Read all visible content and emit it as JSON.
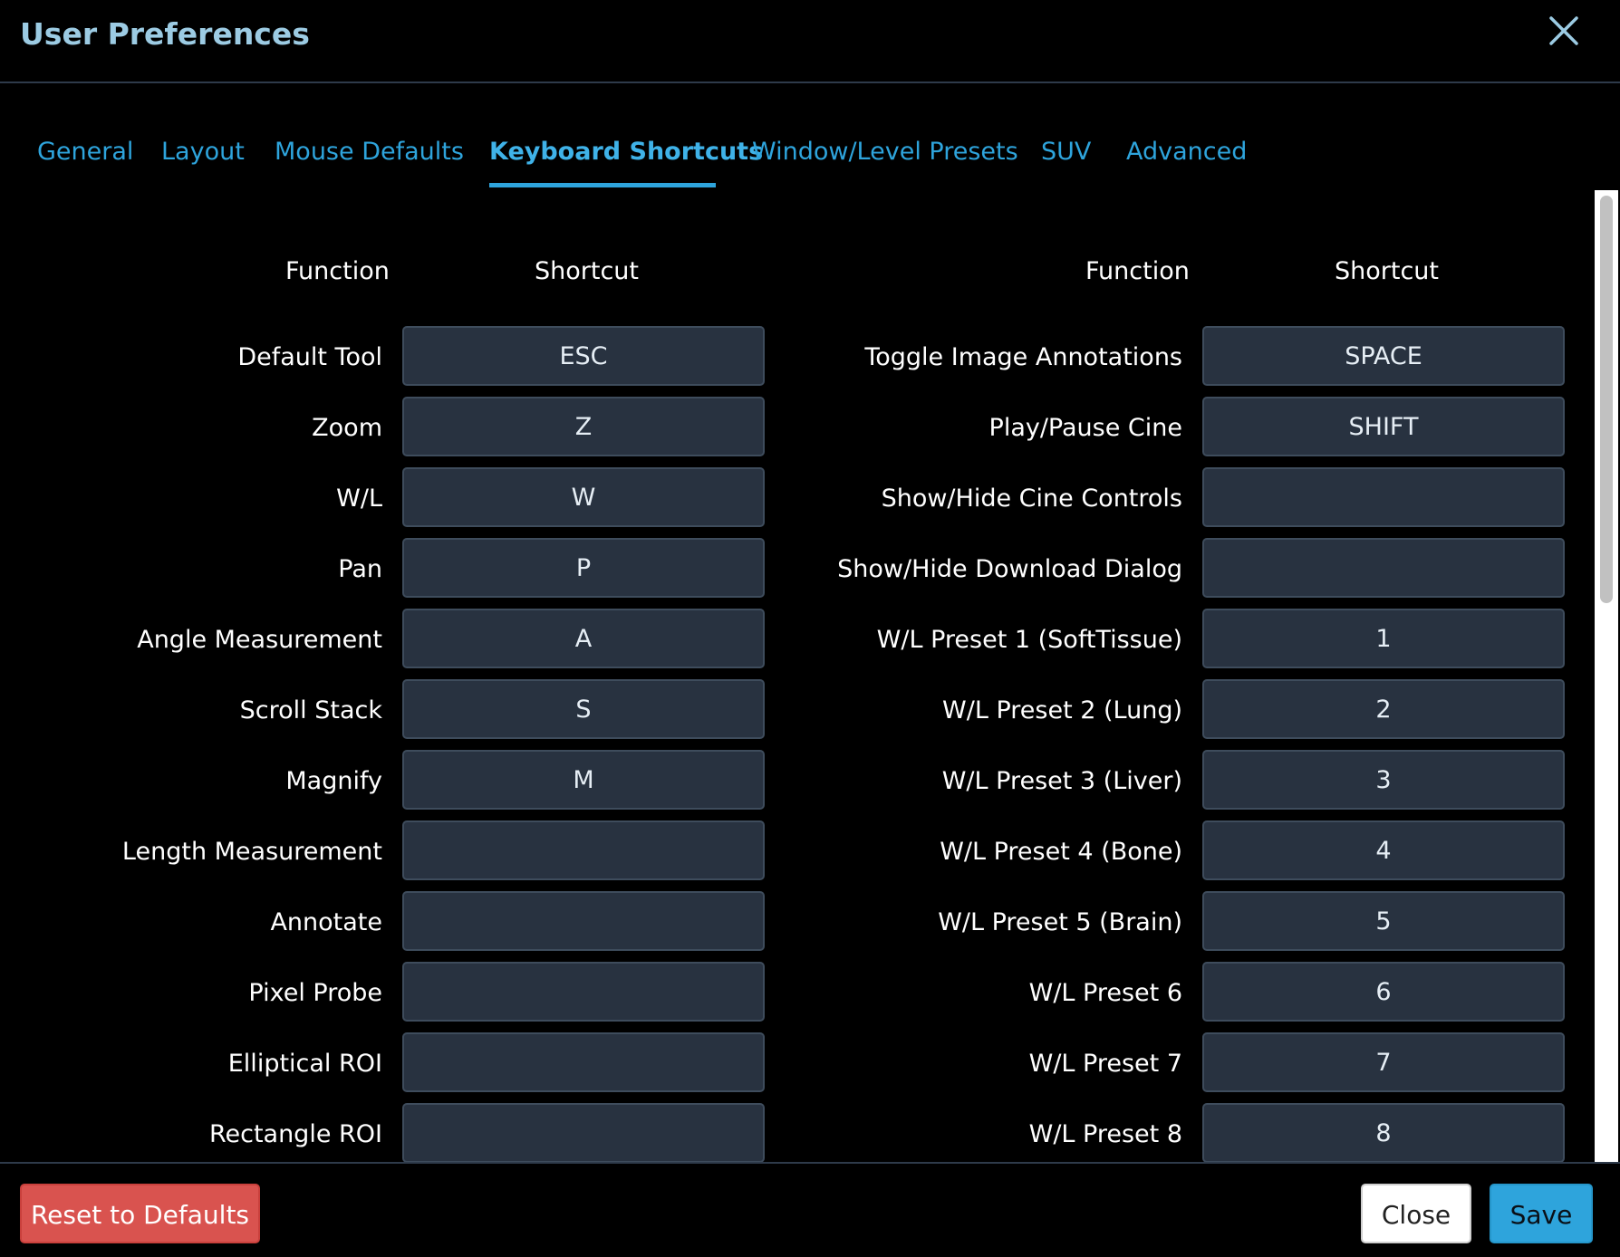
{
  "header": {
    "title": "User Preferences",
    "close_icon": "close-icon"
  },
  "tabs": [
    {
      "label": "General",
      "active": false
    },
    {
      "label": "Layout",
      "active": false
    },
    {
      "label": "Mouse Defaults",
      "active": false
    },
    {
      "label": "Keyboard Shortcuts",
      "active": true
    },
    {
      "label": "Window/Level Presets",
      "active": false
    },
    {
      "label": "SUV",
      "active": false
    },
    {
      "label": "Advanced",
      "active": false
    }
  ],
  "table": {
    "left": {
      "function_header": "Function",
      "shortcut_header": "Shortcut",
      "rows": [
        {
          "function": "Default Tool",
          "shortcut": "ESC"
        },
        {
          "function": "Zoom",
          "shortcut": "Z"
        },
        {
          "function": "W/L",
          "shortcut": "W"
        },
        {
          "function": "Pan",
          "shortcut": "P"
        },
        {
          "function": "Angle Measurement",
          "shortcut": "A"
        },
        {
          "function": "Scroll Stack",
          "shortcut": "S"
        },
        {
          "function": "Magnify",
          "shortcut": "M"
        },
        {
          "function": "Length Measurement",
          "shortcut": ""
        },
        {
          "function": "Annotate",
          "shortcut": ""
        },
        {
          "function": "Pixel Probe",
          "shortcut": ""
        },
        {
          "function": "Elliptical ROI",
          "shortcut": ""
        },
        {
          "function": "Rectangle ROI",
          "shortcut": ""
        }
      ]
    },
    "right": {
      "function_header": "Function",
      "shortcut_header": "Shortcut",
      "rows": [
        {
          "function": "Toggle Image Annotations",
          "shortcut": "SPACE"
        },
        {
          "function": "Play/Pause Cine",
          "shortcut": "SHIFT"
        },
        {
          "function": "Show/Hide Cine Controls",
          "shortcut": ""
        },
        {
          "function": "Show/Hide Download Dialog",
          "shortcut": ""
        },
        {
          "function": "W/L Preset 1 (SoftTissue)",
          "shortcut": "1"
        },
        {
          "function": "W/L Preset 2 (Lung)",
          "shortcut": "2"
        },
        {
          "function": "W/L Preset 3 (Liver)",
          "shortcut": "3"
        },
        {
          "function": "W/L Preset 4 (Bone)",
          "shortcut": "4"
        },
        {
          "function": "W/L Preset 5 (Brain)",
          "shortcut": "5"
        },
        {
          "function": "W/L Preset 6",
          "shortcut": "6"
        },
        {
          "function": "W/L Preset 7",
          "shortcut": "7"
        },
        {
          "function": "W/L Preset 8",
          "shortcut": "8"
        }
      ]
    }
  },
  "footer": {
    "reset_label": "Reset to Defaults",
    "close_label": "Close",
    "save_label": "Save"
  },
  "colors": {
    "accent": "#2ea4dc",
    "danger": "#d9534f",
    "key_box_bg": "#283240",
    "title": "#9ccbe3"
  }
}
